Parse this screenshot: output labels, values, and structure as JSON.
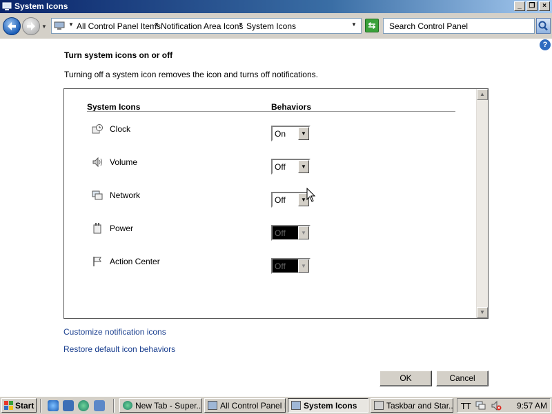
{
  "window": {
    "title": "System Icons"
  },
  "address": {
    "segments": [
      "All Control Panel Items",
      "Notification Area Icons",
      "System Icons"
    ],
    "search_placeholder": "Search Control Panel"
  },
  "page": {
    "heading": "Turn system icons on or off",
    "description": "Turning off a system icon removes the icon and turns off notifications.",
    "col_icons": "System Icons",
    "col_behaviors": "Behaviors",
    "rows": [
      {
        "label": "Clock",
        "value": "On",
        "enabled": true,
        "icon": "clock-icon"
      },
      {
        "label": "Volume",
        "value": "Off",
        "enabled": true,
        "icon": "volume-icon"
      },
      {
        "label": "Network",
        "value": "Off",
        "enabled": true,
        "icon": "network-icon"
      },
      {
        "label": "Power",
        "value": "Off",
        "enabled": false,
        "icon": "power-icon"
      },
      {
        "label": "Action Center",
        "value": "Off",
        "enabled": false,
        "icon": "flag-icon"
      }
    ],
    "link_customize": "Customize notification icons",
    "link_restore": "Restore default icon behaviors",
    "ok_label": "OK",
    "cancel_label": "Cancel"
  },
  "taskbar": {
    "start_label": "Start",
    "tasks": [
      {
        "label": "New Tab - Super...",
        "active": false
      },
      {
        "label": "All Control Panel I...",
        "active": false
      },
      {
        "label": "System Icons",
        "active": true
      },
      {
        "label": "Taskbar and Star...",
        "active": false
      }
    ],
    "clock": "9:57 AM"
  },
  "colors": {
    "title_start": "#0a246a",
    "title_end": "#a6caf0",
    "link": "#1a3f8f",
    "face": "#d4d0c8"
  }
}
